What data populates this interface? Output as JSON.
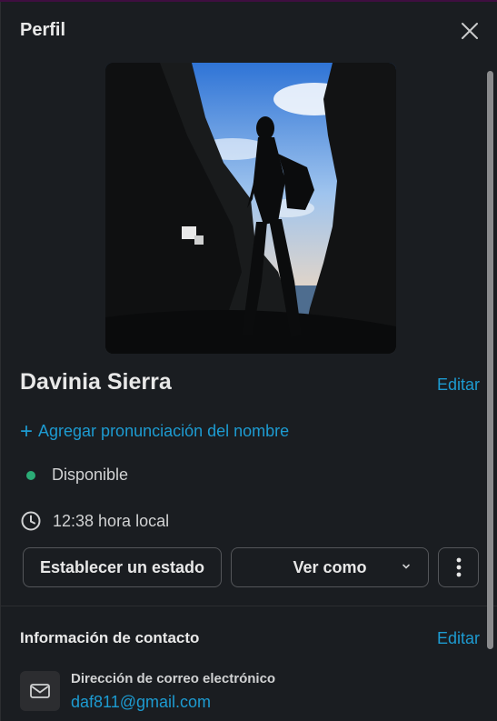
{
  "panel": {
    "title": "Perfil"
  },
  "profile": {
    "name": "Davinia Sierra",
    "edit_label": "Editar",
    "pronunciation_label": "Agregar pronunciación del nombre",
    "status_text": "Disponible",
    "status_color": "#2bac76",
    "local_time": "12:38 hora local"
  },
  "actions": {
    "set_status": "Establecer un estado",
    "view_as": "Ver como"
  },
  "contact": {
    "title": "Información de contacto",
    "edit_label": "Editar",
    "email_label": "Dirección de correo electrónico",
    "email_value": "daf811@gmail.com"
  },
  "colors": {
    "link": "#1d9bd1",
    "background": "#1a1d21"
  }
}
